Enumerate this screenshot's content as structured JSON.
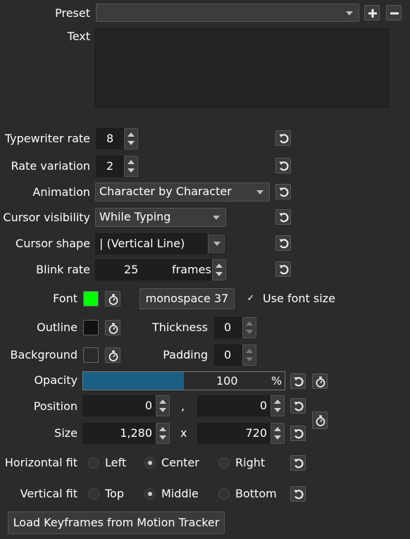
{
  "colors": {
    "font_color": "#00ff00",
    "outline_color": "#111111",
    "background_color": "#2b2b2b",
    "opacity_fill": "#1b5f84"
  },
  "preset": {
    "label": "Preset",
    "value": ""
  },
  "text": {
    "label": "Text",
    "value": ""
  },
  "typewriter_rate": {
    "label": "Typewriter rate",
    "value": "8"
  },
  "rate_variation": {
    "label": "Rate variation",
    "value": "2"
  },
  "animation": {
    "label": "Animation",
    "value": "Character by Character"
  },
  "cursor_visibility": {
    "label": "Cursor visibility",
    "value": "While Typing"
  },
  "cursor_shape": {
    "label": "Cursor shape",
    "value": "| (Vertical Line)"
  },
  "blink_rate": {
    "label": "Blink rate",
    "value": "25",
    "suffix": "frames"
  },
  "font": {
    "label": "Font",
    "button": "monospace 37",
    "use_font_size_label": "Use font size",
    "use_font_size_checked": true,
    "checkmark": "✓"
  },
  "outline": {
    "label": "Outline",
    "thickness_label": "Thickness",
    "thickness": "0"
  },
  "background": {
    "label": "Background",
    "padding_label": "Padding",
    "padding": "0"
  },
  "opacity": {
    "label": "Opacity",
    "value": "100",
    "unit": "%",
    "fill_fraction": 0.5
  },
  "position": {
    "label": "Position",
    "x": "0",
    "sep": ",",
    "y": "0"
  },
  "size": {
    "label": "Size",
    "w": "1,280",
    "sep": "x",
    "h": "720"
  },
  "horizontal_fit": {
    "label": "Horizontal fit",
    "options": [
      "Left",
      "Center",
      "Right"
    ],
    "selected": "Center"
  },
  "vertical_fit": {
    "label": "Vertical fit",
    "options": [
      "Top",
      "Middle",
      "Bottom"
    ],
    "selected": "Middle"
  },
  "load_keyframes": {
    "label": "Load Keyframes from Motion Tracker"
  }
}
